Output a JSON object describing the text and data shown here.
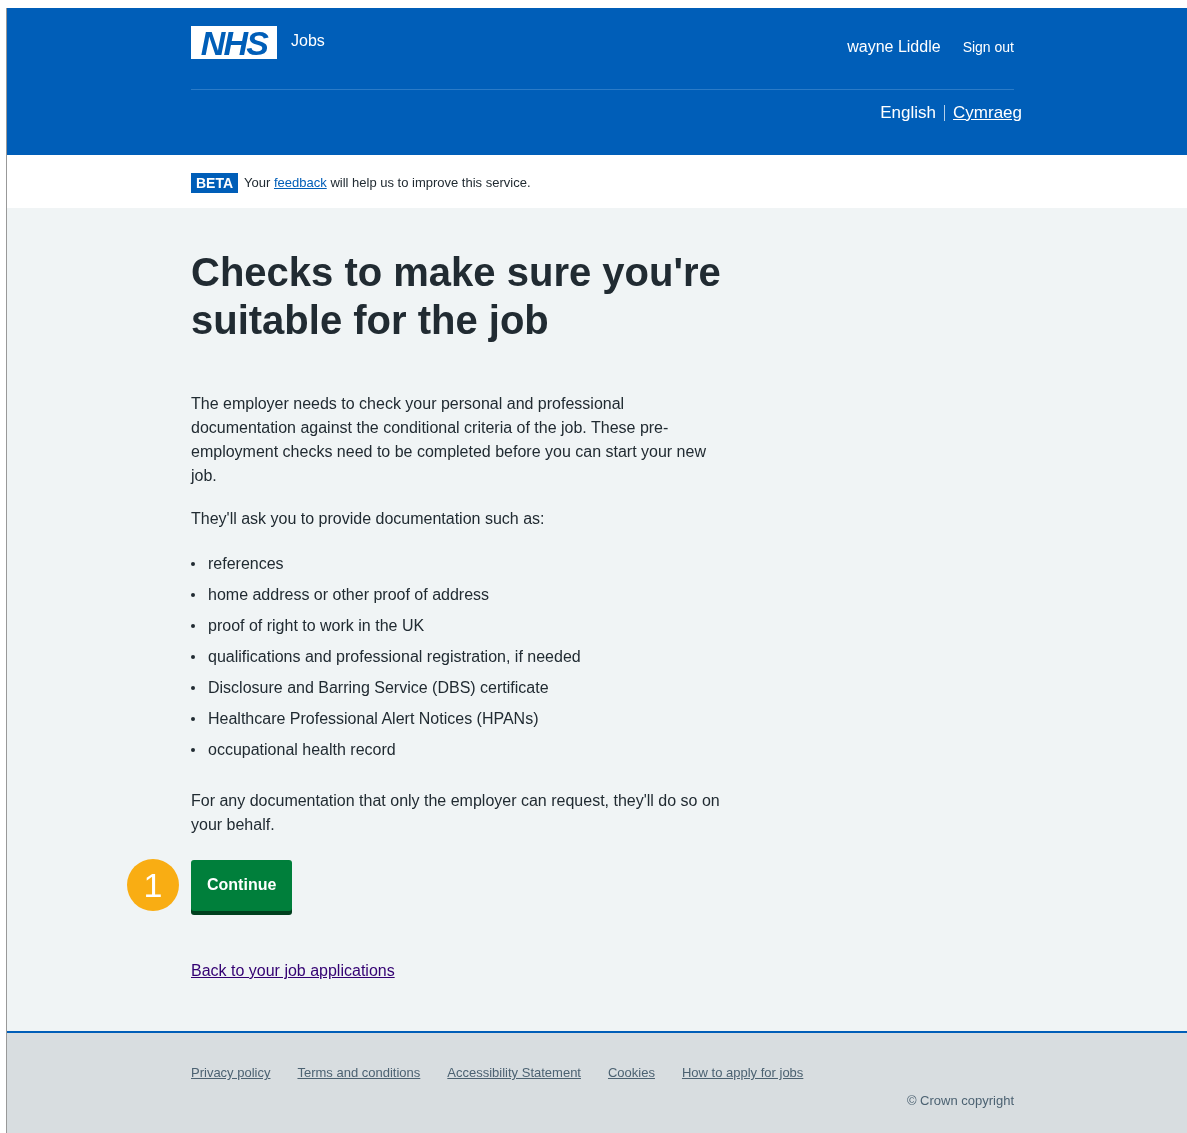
{
  "header": {
    "logo_text": "NHS",
    "service_name": "Jobs",
    "user_name": "wayne Liddle",
    "sign_out": "Sign out",
    "languages": [
      {
        "label": "English",
        "selected": true
      },
      {
        "label": "Cymraeg",
        "selected": false
      }
    ]
  },
  "beta_banner": {
    "tag": "BETA",
    "message_start": "Your",
    "link": "feedback",
    "message_end": "will help us to improve this service."
  },
  "main": {
    "title": "Checks to make sure you're suitable for the job",
    "paragraphs": [
      "The employer needs to check your personal and professional documentation against the conditional criteria of the job. These pre-employment checks need to be completed before you can start your new job.",
      "They'll ask you to provide documentation such as:"
    ],
    "list": [
      "references",
      "home address or other proof of address",
      "proof of right to work in the UK",
      "qualifications and professional registration, if needed",
      "Disclosure and Barring Service (DBS) certificate",
      "Healthcare Professional Alert Notices (HPANs)",
      "occupational health record"
    ],
    "closing": "For any documentation that only the employer can request, they'll do so on your behalf.",
    "step_marker": "1",
    "button": "Continue",
    "back_link": "Back to your job applications"
  },
  "footer": {
    "links": [
      "Privacy policy",
      "Terms and conditions",
      "Accessibility Statement",
      "Cookies",
      "How to apply for jobs"
    ],
    "copyright": "© Crown copyright"
  }
}
